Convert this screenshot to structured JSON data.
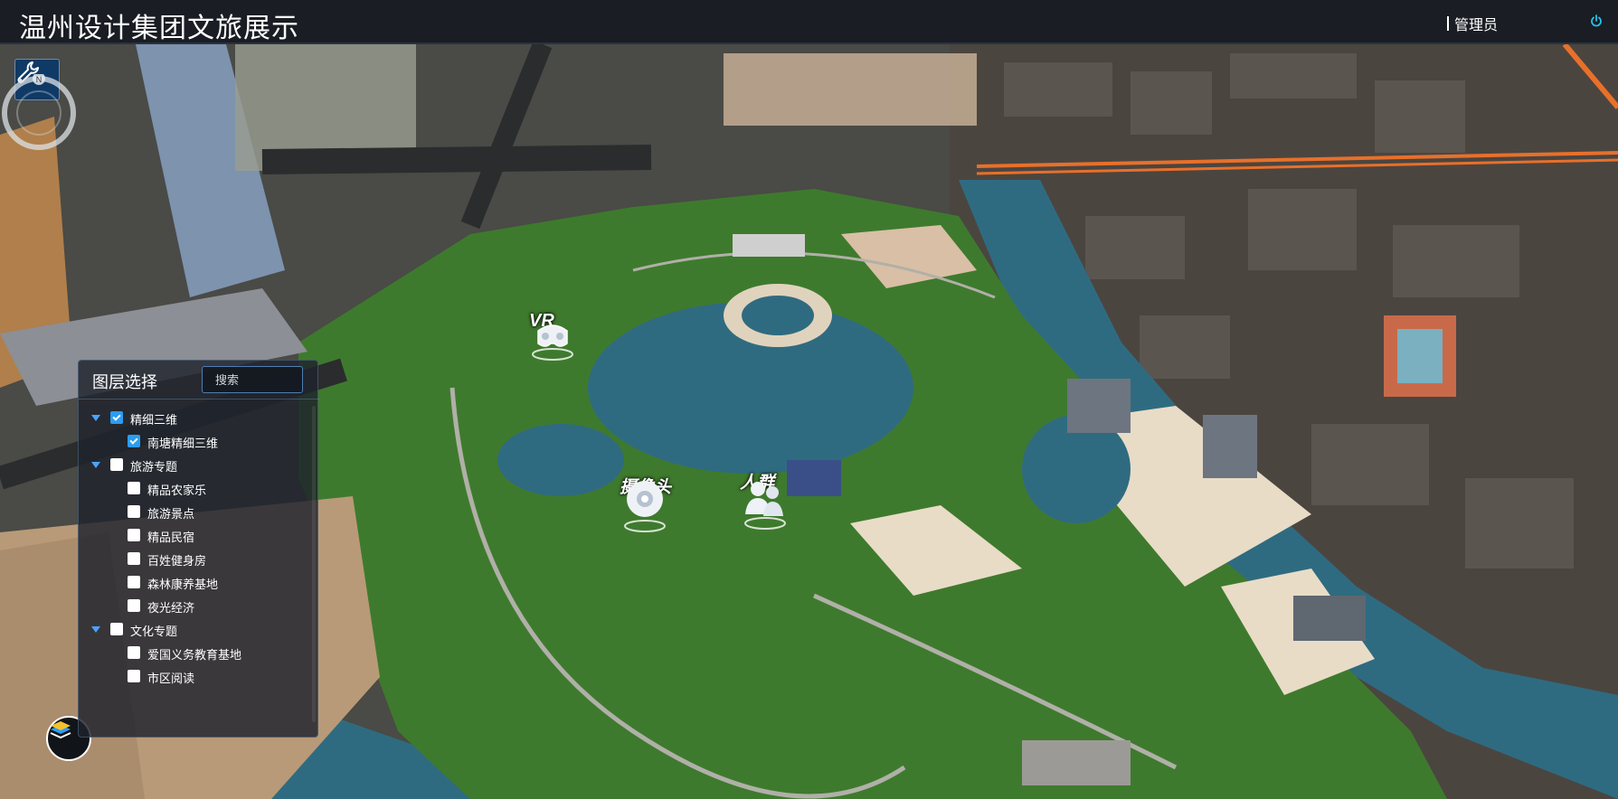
{
  "header": {
    "title": "温州设计集团文旅展示",
    "user_label": "管理员",
    "power_icon": "power-icon"
  },
  "toolbar": {
    "tool_icon": "wrench-icon",
    "compass_icon": "compass-icon",
    "layers_icon": "layers-icon"
  },
  "layer_panel": {
    "title": "图层选择",
    "search_placeholder": "搜索",
    "groups": [
      {
        "label": "精细三维",
        "checked": true,
        "expanded": true,
        "children": [
          {
            "label": "南塘精细三维",
            "checked": true
          }
        ]
      },
      {
        "label": "旅游专题",
        "checked": false,
        "expanded": true,
        "children": [
          {
            "label": "精品农家乐",
            "checked": false
          },
          {
            "label": "旅游景点",
            "checked": false
          },
          {
            "label": "精品民宿",
            "checked": false
          },
          {
            "label": "百姓健身房",
            "checked": false
          },
          {
            "label": "森林康养基地",
            "checked": false
          },
          {
            "label": "夜光经济",
            "checked": false
          }
        ]
      },
      {
        "label": "文化专题",
        "checked": false,
        "expanded": true,
        "children": [
          {
            "label": "爱国义务教育基地",
            "checked": false
          },
          {
            "label": "市区阅读",
            "checked": false
          }
        ]
      }
    ]
  },
  "map": {
    "markers": {
      "vr": {
        "label": "VR",
        "icon": "vr-headset-icon"
      },
      "camera": {
        "label": "摄像头",
        "icon": "camera-icon"
      },
      "crowd": {
        "label": "人群",
        "icon": "crowd-icon"
      }
    },
    "accent_color": "#2b9df2",
    "water_color": "#2f6b80"
  }
}
